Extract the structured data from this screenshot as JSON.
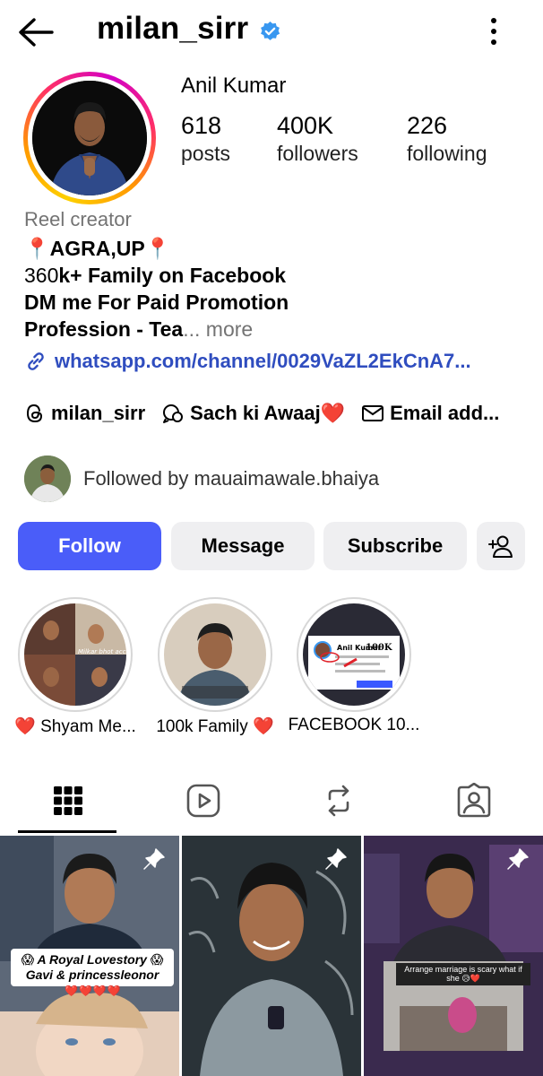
{
  "header": {
    "username": "milan_sirr"
  },
  "profile": {
    "display_name": "Anil Kumar",
    "stats": [
      {
        "value": "618",
        "label": "posts"
      },
      {
        "value": "400K",
        "label": "followers"
      },
      {
        "value": "226",
        "label": "following"
      }
    ],
    "category": "Reel creator",
    "bio": {
      "line1": "📍AGRA,UP📍",
      "line2_prefix": "360",
      "line2_bold": "k+ Family on Facebook",
      "line3": "DM me For Paid Promotion",
      "line4_text": "Profession - Tea",
      "line4_ellipsis": "...",
      "line4_more": " more"
    },
    "link": "whatsapp.com/channel/0029VaZL2EkCnA7...",
    "chips": [
      {
        "label": "milan_sirr",
        "icon": "threads-icon"
      },
      {
        "label": "Sach ki Awaaj❤️",
        "icon": "chat-icon"
      },
      {
        "label": "Email add...",
        "icon": "mail-icon"
      }
    ],
    "followed_by": "Followed by mauaimawale.bhaiya"
  },
  "actions": {
    "follow": "Follow",
    "message": "Message",
    "subscribe": "Subscribe"
  },
  "highlights": [
    {
      "label": "❤️ Shyam Me..."
    },
    {
      "label": "100k Family ❤️"
    },
    {
      "label": "FACEBOOK 10..."
    }
  ],
  "highlight_texts": {
    "h1_overlay": "Milkar bhot accha laga bhaiya",
    "h3_name": "Anil Kumar",
    "h3_count": "100K"
  },
  "tabs": [
    "grid-icon",
    "reels-icon",
    "reposts-icon",
    "tagged-icon"
  ],
  "posts": [
    {
      "caption1": "😱 A Royal Lovestory 😱",
      "caption2": "Gavi & princessleonor",
      "hearts": "❤️❤️❤️❤️"
    },
    {},
    {
      "screen_caption": "Arrange marriage is scary what if she 😥❤️"
    }
  ],
  "colors": {
    "follow": "#4a5df9",
    "link": "#2f4dbf",
    "verified": "#3897f0"
  }
}
